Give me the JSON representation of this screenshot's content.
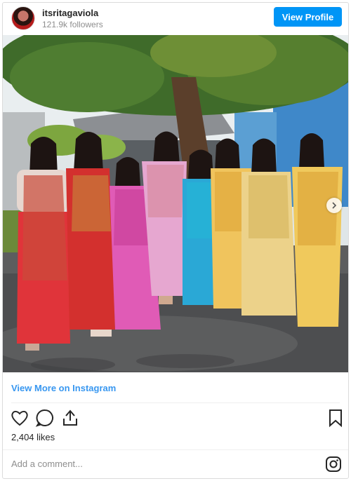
{
  "header": {
    "username": "itsritagaviola",
    "followers": "121.9k followers",
    "view_profile_label": "View Profile"
  },
  "post": {
    "view_more_label": "View More on Instagram",
    "likes": "2,404 likes",
    "comment_placeholder": "Add a comment..."
  },
  "icons": [
    "heart-icon",
    "comment-icon",
    "share-icon",
    "bookmark-icon",
    "instagram-icon",
    "chevron-right-icon"
  ],
  "colors": {
    "accent": "#0095f6",
    "link": "#3897f0",
    "muted": "#8e8e8e",
    "text": "#262626"
  }
}
